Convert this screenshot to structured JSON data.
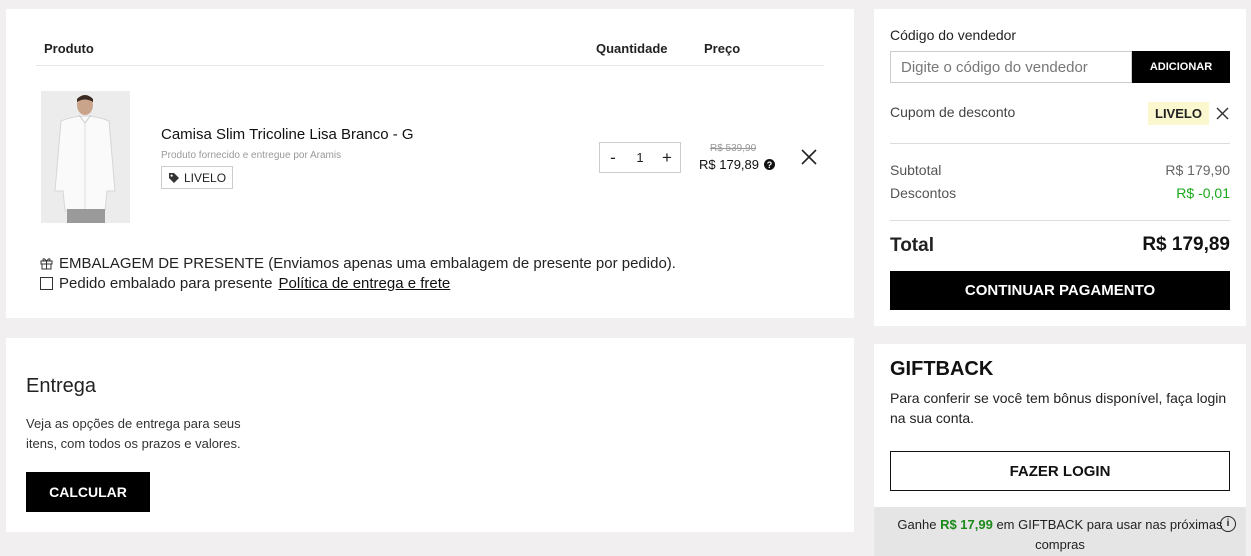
{
  "cart": {
    "header": {
      "product": "Produto",
      "quantity": "Quantidade",
      "price": "Preço"
    },
    "item": {
      "name": "Camisa Slim Tricoline Lisa Branco - G",
      "seller_note": "Produto fornecido e entregue por Aramis",
      "coupon_tag": "LIVELO",
      "quantity": "1",
      "minus": "-",
      "plus": "+",
      "old_price": "R$ 539,90",
      "price": "R$ 179,89",
      "help": "?"
    },
    "gift_wrap": {
      "title": "EMBALAGEM DE PRESENTE (Enviamos apenas uma embalagem de presente por pedido).",
      "checkbox_label": "Pedido embalado para presente",
      "policy_link": "Política de entrega e frete"
    }
  },
  "delivery": {
    "title": "Entrega",
    "text": "Veja as opções de entrega para seus itens, com todos os prazos e valores.",
    "button": "CALCULAR"
  },
  "summary": {
    "seller_label": "Código do vendedor",
    "seller_placeholder": "Digite o código do vendedor",
    "add_button": "ADICIONAR",
    "coupon_label": "Cupom de desconto",
    "coupon_value": "LIVELO",
    "subtotal_label": "Subtotal",
    "subtotal_value": "R$ 179,90",
    "discount_label": "Descontos",
    "discount_value": "R$ -0,01",
    "total_label": "Total",
    "total_value": "R$ 179,89",
    "pay_button": "CONTINUAR PAGAMENTO"
  },
  "giftback": {
    "title": "GIFTBACK",
    "text": "Para conferir se você tem bônus disponível, faça login na sua conta.",
    "login_button": "FAZER LOGIN",
    "footer_prefix": "Ganhe ",
    "footer_amount": "R$ 17,99",
    "footer_suffix": " em GIFTBACK para usar nas próximas compras",
    "info": "i"
  },
  "colors": {
    "accent_green": "#1aa81a",
    "coupon_badge_bg": "#fbf8cf",
    "button_black": "#000000"
  }
}
